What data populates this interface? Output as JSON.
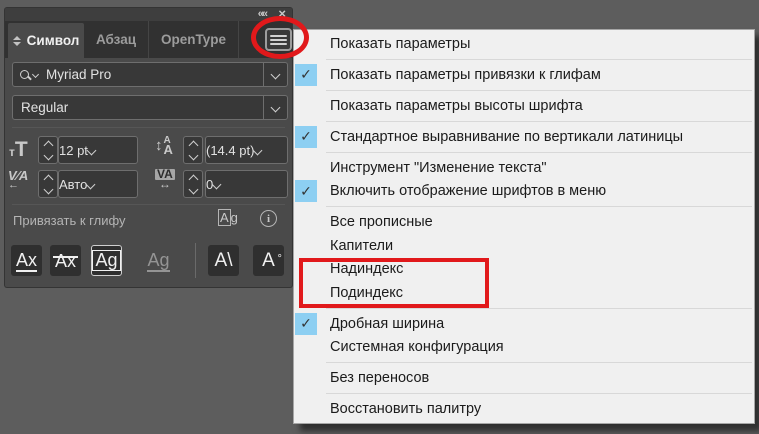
{
  "panel": {
    "titlebar": {
      "collapse_glyph": "««",
      "close_glyph": "×"
    },
    "tabs": [
      {
        "label": "Символ",
        "active": true
      },
      {
        "label": "Абзац",
        "active": false
      },
      {
        "label": "OpenType",
        "active": false
      }
    ],
    "font_family": "Myriad Pro",
    "font_style": "Regular",
    "size_value": "12 pt",
    "leading_value": "(14.4 pt)",
    "kerning_value": "Авто",
    "tracking_value": "0",
    "snap_section_label": "Привязать к глифу",
    "icons": {
      "size_small": "т",
      "size_large": "T",
      "leading_updown": "↕",
      "leading_a_top": "A",
      "leading_a_bottom": "A",
      "kern_text": "V∕A",
      "kern_arrow": "←",
      "track_text": "VA",
      "track_arrow": "↔",
      "ag_mini_a": "A",
      "ag_mini_g": "g",
      "info_i": "i"
    },
    "glyph_buttons": [
      {
        "glyph": "Ax",
        "name": "snap-baseline"
      },
      {
        "glyph": "Ax",
        "name": "snap-x-height"
      },
      {
        "glyph": "Ag",
        "name": "snap-glyph-bounds"
      },
      {
        "glyph": "Ag",
        "name": "snap-disabled"
      },
      {
        "glyph": "A\\",
        "name": "snap-angular-guides"
      },
      {
        "glyph": "A",
        "name": "snap-anchor-point"
      }
    ],
    "anchor_ring": "°"
  },
  "menu": {
    "check_glyph": "✓",
    "items": [
      {
        "label": "Показать параметры",
        "checked": false,
        "sep_after": true
      },
      {
        "label": "Показать параметры привязки к глифам",
        "checked": true,
        "sep_after": true
      },
      {
        "label": "Показать параметры высоты шрифта",
        "checked": false,
        "sep_after": true
      },
      {
        "label": "Стандартное выравнивание по вертикали латиницы",
        "checked": true,
        "sep_after": true
      },
      {
        "label": "Инструмент \"Изменение текста\"",
        "checked": false,
        "sep_after": false
      },
      {
        "label": "Включить отображение шрифтов в меню",
        "checked": true,
        "sep_after": true
      },
      {
        "label": "Все прописные",
        "checked": false,
        "sep_after": false
      },
      {
        "label": "Капители",
        "checked": false,
        "sep_after": false
      },
      {
        "label": "Надиндекс",
        "checked": false,
        "sep_after": false
      },
      {
        "label": "Подиндекс",
        "checked": false,
        "sep_after": true
      },
      {
        "label": "Дробная ширина",
        "checked": true,
        "sep_after": false
      },
      {
        "label": "Системная конфигурация",
        "checked": false,
        "sep_after": true
      },
      {
        "label": "Без переносов",
        "checked": false,
        "sep_after": true
      },
      {
        "label": "Восстановить палитру",
        "checked": false,
        "sep_after": false
      }
    ]
  },
  "colors": {
    "annotation_red": "#e1191b",
    "check_blue": "#8dcff2",
    "panel_bg": "#4a4a4a",
    "menu_bg": "#f0f0f0"
  }
}
